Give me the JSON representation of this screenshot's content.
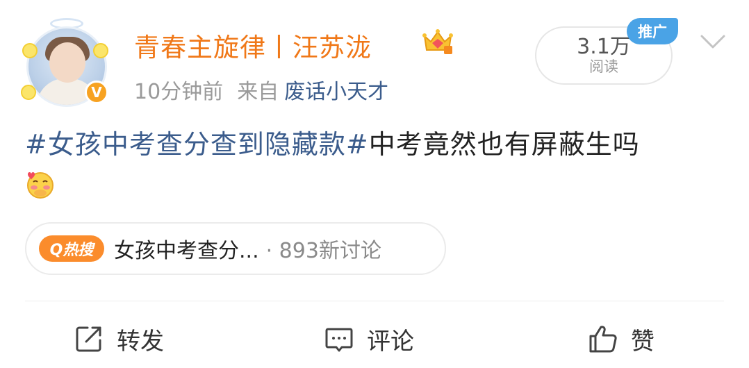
{
  "post": {
    "username": "青春主旋律丨汪苏泷",
    "time": "10分钟前",
    "source_prefix": "来自",
    "source_app": "废话小天才",
    "reads": {
      "count": "3.1万",
      "label": "阅读"
    },
    "ad_tag": "推广",
    "hashtag": "#女孩中考查分查到隐藏款#",
    "text": "中考竟然也有屏蔽生吗",
    "hot_search": {
      "badge": "Q热搜",
      "topic": "女孩中考查分...",
      "count": "· 893新讨论"
    }
  },
  "actions": {
    "repost": "转发",
    "comment": "评论",
    "like": "赞"
  },
  "colors": {
    "username": "#f07818",
    "link": "#3b5c8c",
    "hot_badge": "#fb8c2c",
    "ad_tag": "#4aa3e6"
  }
}
